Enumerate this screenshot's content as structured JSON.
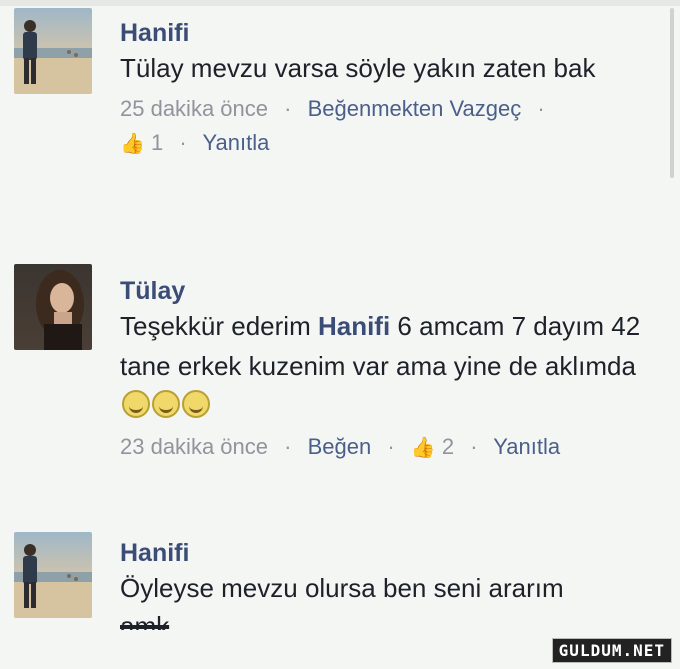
{
  "comments": [
    {
      "author": "Hanifi",
      "text": "Tülay mevzu varsa söyle yakın zaten bak",
      "time": "25 dakika önce",
      "action": "Beğenmekten Vazgeç",
      "likes": "1",
      "reply": "Yanıtla"
    },
    {
      "author": "Tülay",
      "text_before": "Teşekkür ederim ",
      "mention": "Hanifi",
      "text_after": " 6 amcam 7 dayım 42 tane erkek kuzenim var ama yine de aklımda",
      "emoji_icons": [
        "laughing-emoji",
        "laughing-emoji",
        "laughing-emoji"
      ],
      "time": "23 dakika önce",
      "action": "Beğen",
      "likes": "2",
      "reply": "Yanıtla"
    },
    {
      "author": "Hanifi",
      "text": "Öyleyse mevzu olursa ben seni ararım",
      "text_cut": "amk"
    }
  ],
  "watermark": "GULDUM.NET",
  "colors": {
    "name": "#3b4d77",
    "meta": "#90949c",
    "link": "#4b5f8a"
  }
}
